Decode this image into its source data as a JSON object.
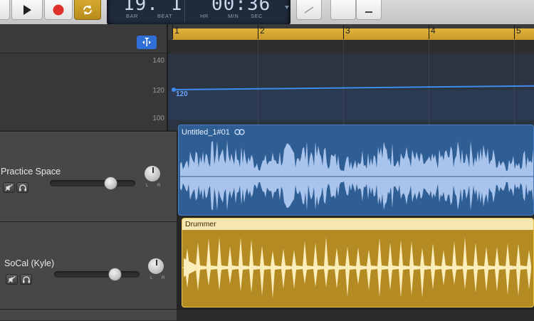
{
  "transport": {
    "lcd": {
      "bar_value": "19. 1",
      "bar_caption": "BAR",
      "beat_caption": "BEAT",
      "time_value": "00:36",
      "hr_caption": "HR",
      "min_caption": "MIN",
      "sec_caption": "SEC"
    }
  },
  "ruler": {
    "bars": [
      "1",
      "2",
      "3",
      "4",
      "5"
    ]
  },
  "tempo_track": {
    "scale": [
      "140",
      "120",
      "100"
    ],
    "current_tempo": "120"
  },
  "tracks": [
    {
      "name": "Practice Space",
      "region_title": "Untitled_1#01",
      "pan_left": "L",
      "pan_right": "R",
      "volume": 0.72
    },
    {
      "name": "SoCal (Kyle)",
      "region_title": "Drummer",
      "pan_left": "L",
      "pan_right": "R",
      "volume": 0.72
    }
  ],
  "colors": {
    "audio_region": "#2f5e94",
    "audio_wave": "#a9c4ec",
    "drummer_region": "#b48a22",
    "drummer_wave": "#fbeebb",
    "tempo_line": "#3f8cf0",
    "cycle_bar": "#d9aa35",
    "record": "#e0302a"
  },
  "icons": [
    "play-icon",
    "record-icon",
    "cycle-icon",
    "catch-icon",
    "mute-icon",
    "headphones-icon",
    "loop-icon"
  ]
}
